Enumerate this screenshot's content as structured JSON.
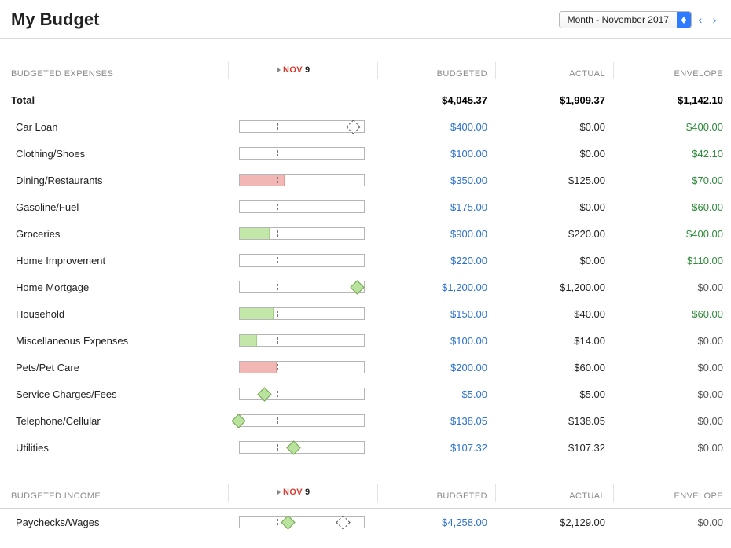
{
  "header": {
    "title": "My Budget",
    "period_label": "Month - November 2017"
  },
  "columns": {
    "budgeted": "BUDGETED",
    "actual": "ACTUAL",
    "envelope": "ENVELOPE"
  },
  "today": {
    "month": "NOV",
    "day": "9"
  },
  "expenses": {
    "section_label": "BUDGETED EXPENSES",
    "total": {
      "label": "Total",
      "budgeted": "$4,045.37",
      "actual": "$1,909.37",
      "envelope": "$1,142.10"
    },
    "rows": [
      {
        "name": "Car Loan",
        "budgeted": "$400.00",
        "actual": "$0.00",
        "envelope": "$400.00",
        "env_pos": true,
        "fill_pct": 0,
        "fill_color": "",
        "diamonds": [
          {
            "type": "dashed",
            "pos": 138
          }
        ]
      },
      {
        "name": "Clothing/Shoes",
        "budgeted": "$100.00",
        "actual": "$0.00",
        "envelope": "$42.10",
        "env_pos": true,
        "fill_pct": 0,
        "fill_color": "",
        "diamonds": []
      },
      {
        "name": "Dining/Restaurants",
        "budgeted": "$350.00",
        "actual": "$125.00",
        "envelope": "$70.00",
        "env_pos": true,
        "fill_pct": 36,
        "fill_color": "red",
        "diamonds": []
      },
      {
        "name": "Gasoline/Fuel",
        "budgeted": "$175.00",
        "actual": "$0.00",
        "envelope": "$60.00",
        "env_pos": true,
        "fill_pct": 0,
        "fill_color": "",
        "diamonds": []
      },
      {
        "name": "Groceries",
        "budgeted": "$900.00",
        "actual": "$220.00",
        "envelope": "$400.00",
        "env_pos": true,
        "fill_pct": 24,
        "fill_color": "green",
        "diamonds": []
      },
      {
        "name": "Home Improvement",
        "budgeted": "$220.00",
        "actual": "$0.00",
        "envelope": "$110.00",
        "env_pos": true,
        "fill_pct": 0,
        "fill_color": "",
        "diamonds": []
      },
      {
        "name": "Home Mortgage",
        "budgeted": "$1,200.00",
        "actual": "$1,200.00",
        "envelope": "$0.00",
        "env_pos": false,
        "fill_pct": 0,
        "fill_color": "",
        "diamonds": [
          {
            "type": "solid",
            "pos": 143
          }
        ]
      },
      {
        "name": "Household",
        "budgeted": "$150.00",
        "actual": "$40.00",
        "envelope": "$60.00",
        "env_pos": true,
        "fill_pct": 27,
        "fill_color": "green",
        "diamonds": []
      },
      {
        "name": "Miscellaneous Expenses",
        "budgeted": "$100.00",
        "actual": "$14.00",
        "envelope": "$0.00",
        "env_pos": false,
        "fill_pct": 14,
        "fill_color": "green",
        "diamonds": []
      },
      {
        "name": "Pets/Pet Care",
        "budgeted": "$200.00",
        "actual": "$60.00",
        "envelope": "$0.00",
        "env_pos": false,
        "fill_pct": 30,
        "fill_color": "red",
        "diamonds": []
      },
      {
        "name": "Service Charges/Fees",
        "budgeted": "$5.00",
        "actual": "$5.00",
        "envelope": "$0.00",
        "env_pos": false,
        "fill_pct": 0,
        "fill_color": "",
        "diamonds": [
          {
            "type": "solid",
            "pos": 25
          }
        ]
      },
      {
        "name": "Telephone/Cellular",
        "budgeted": "$138.05",
        "actual": "$138.05",
        "envelope": "$0.00",
        "env_pos": false,
        "fill_pct": 0,
        "fill_color": "",
        "diamonds": [
          {
            "type": "solid",
            "pos": -8
          }
        ]
      },
      {
        "name": "Utilities",
        "budgeted": "$107.32",
        "actual": "$107.32",
        "envelope": "$0.00",
        "env_pos": false,
        "fill_pct": 0,
        "fill_color": "",
        "diamonds": [
          {
            "type": "solid",
            "pos": 62
          }
        ]
      }
    ]
  },
  "income": {
    "section_label": "BUDGETED INCOME",
    "rows": [
      {
        "name": "Paychecks/Wages",
        "budgeted": "$4,258.00",
        "actual": "$2,129.00",
        "envelope": "$0.00",
        "env_pos": false,
        "fill_pct": 0,
        "fill_color": "",
        "diamonds": [
          {
            "type": "solid",
            "pos": 55
          },
          {
            "type": "dashed",
            "pos": 125
          }
        ]
      }
    ]
  }
}
